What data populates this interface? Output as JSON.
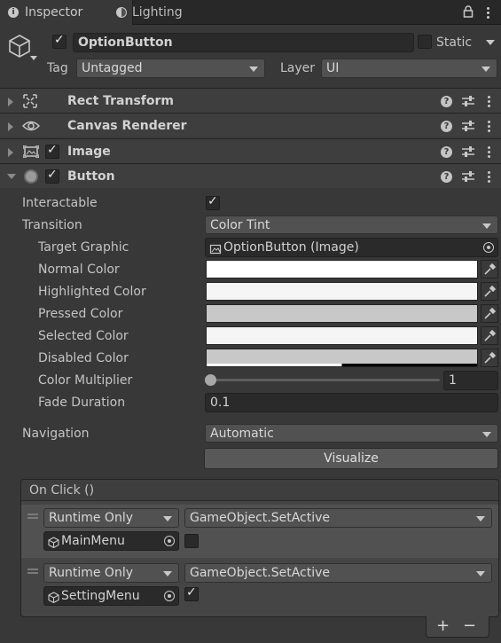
{
  "tabs": [
    {
      "label": "Inspector",
      "icon": "info-icon"
    },
    {
      "label": "Lighting",
      "icon": "lighting-icon"
    }
  ],
  "object": {
    "name": "OptionButton",
    "active": true,
    "static_label": "Static",
    "static_checked": false,
    "tag_label": "Tag",
    "tag_value": "Untagged",
    "layer_label": "Layer",
    "layer_value": "UI"
  },
  "components": [
    {
      "name": "Rect Transform",
      "icon": "rect-transform-icon",
      "expanded": false
    },
    {
      "name": "Canvas Renderer",
      "icon": "eye-icon",
      "expanded": false
    },
    {
      "name": "Image",
      "icon": "image-icon",
      "enabled": true,
      "expanded": false
    },
    {
      "name": "Button",
      "icon": "button-icon",
      "enabled": true,
      "expanded": true
    }
  ],
  "button": {
    "interactable_label": "Interactable",
    "interactable": true,
    "transition_label": "Transition",
    "transition_value": "Color Tint",
    "target_graphic_label": "Target Graphic",
    "target_graphic_value": "OptionButton (Image)",
    "normal_color_label": "Normal Color",
    "normal_color": "#ffffff",
    "highlighted_color_label": "Highlighted Color",
    "highlighted_color": "#f5f5f5",
    "pressed_color_label": "Pressed Color",
    "pressed_color": "#c8c8c8",
    "selected_color_label": "Selected Color",
    "selected_color": "#f5f5f5",
    "disabled_color_label": "Disabled Color",
    "disabled_color": "#c8c8c8",
    "disabled_alpha": 0.5,
    "color_multiplier_label": "Color Multiplier",
    "color_multiplier_value": "1",
    "color_multiplier_fraction": 0,
    "fade_duration_label": "Fade Duration",
    "fade_duration_value": "0.1",
    "navigation_label": "Navigation",
    "navigation_value": "Automatic",
    "visualize_label": "Visualize"
  },
  "onclick": {
    "title": "On Click ()",
    "events": [
      {
        "mode": "Runtime Only",
        "function": "GameObject.SetActive",
        "target": "MainMenu",
        "arg_checked": false
      },
      {
        "mode": "Runtime Only",
        "function": "GameObject.SetActive",
        "target": "SettingMenu",
        "arg_checked": true
      }
    ],
    "add_label": "+",
    "remove_label": "−"
  }
}
